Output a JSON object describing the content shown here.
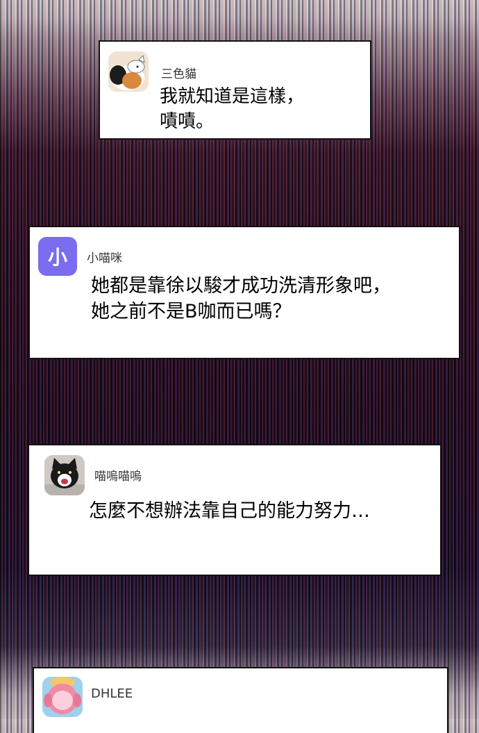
{
  "comments": [
    {
      "username": "三色貓",
      "message_lines": [
        "我就知道是這樣，",
        "嘖嘖。"
      ]
    },
    {
      "username": "小喵咪",
      "avatar_letter": "小",
      "message_lines": [
        "她都是靠徐以駿才成功洗清形象吧，",
        "她之前不是B咖而已嗎？"
      ]
    },
    {
      "username": "喵嗚喵嗚",
      "message_lines": [
        "怎麼不想辦法靠自己的能力努力…"
      ]
    },
    {
      "username": "DHLEE",
      "message_lines": []
    }
  ],
  "colors": {
    "card_background": "#ffffff",
    "card_border": "#111111",
    "letter_avatar": "#7b6cf0"
  }
}
